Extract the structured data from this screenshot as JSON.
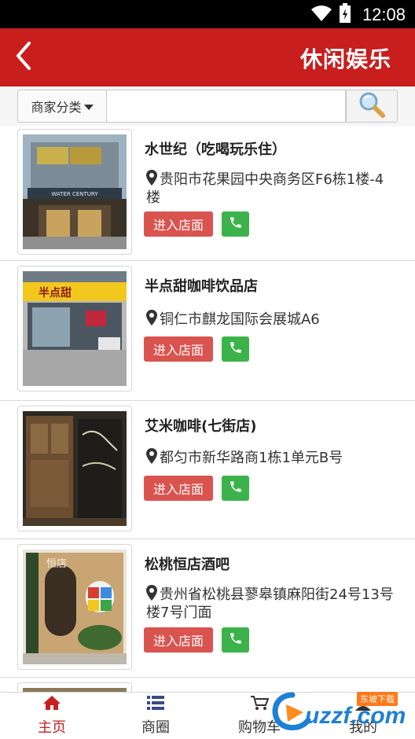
{
  "status_bar": {
    "time": "12:08"
  },
  "app_bar": {
    "title": "休闲娱乐"
  },
  "search": {
    "category_label": "商家分类",
    "value": "",
    "placeholder": ""
  },
  "shops": [
    {
      "name": "水世纪（吃喝玩乐住）",
      "address": "贵阳市花果园中央商务区F6栋1楼-4楼",
      "enter_label": "进入店面",
      "photo_sign": "WATER CENTURY"
    },
    {
      "name": "半点甜咖啡饮品店",
      "address": "铜仁市麒龙国际会展城A6",
      "enter_label": "进入店面",
      "photo_sign": "半点甜"
    },
    {
      "name": "艾米咖啡(七街店)",
      "address": "都匀市新华路商1栋1单元B号",
      "enter_label": "进入店面"
    },
    {
      "name": "松桃恒店酒吧",
      "address": "贵州省松桃县蓼皋镇麻阳街24号13号楼7号门面",
      "enter_label": "进入店面",
      "photo_sign": "恒店"
    }
  ],
  "bottom_nav": [
    {
      "label": "主页",
      "icon": "home-icon",
      "active": true
    },
    {
      "label": "商圈",
      "icon": "list-icon",
      "active": false
    },
    {
      "label": "购物车",
      "icon": "cart-icon",
      "active": false
    },
    {
      "label": "我的",
      "icon": "user-icon",
      "active": false
    }
  ],
  "watermark": {
    "text": "uzzf.com",
    "badge": "东坡下载"
  },
  "colors": {
    "brand_red": "#c81e1e",
    "enter_button": "#d9534f",
    "phone_button": "#3cb34a"
  }
}
